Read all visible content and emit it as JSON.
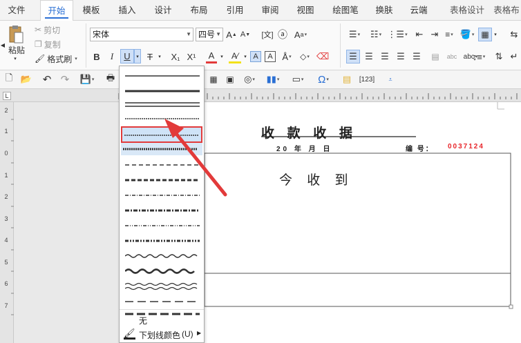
{
  "menu": {
    "tabs": [
      "文件",
      "开始",
      "模板",
      "插入",
      "设计",
      "布局",
      "引用",
      "审阅",
      "视图",
      "绘图笔",
      "换肤",
      "云端",
      "表格设计",
      "表格布"
    ],
    "active": "开始"
  },
  "ribbon": {
    "paste_label": "粘贴",
    "cut_label": "剪切",
    "copy_label": "复制",
    "format_painter_label": "格式刷",
    "font_name": "宋体",
    "font_size": "四号",
    "bold": "B",
    "italic": "I",
    "underline": "U",
    "strikethrough": "T",
    "subscript": "X₁",
    "superscript": "X¹",
    "font_color_letter": "A"
  },
  "underline_menu": {
    "none_label": "无",
    "color_label": "下划线颜色",
    "color_shortcut": "(U)"
  },
  "ruler": {
    "vertical_numbers": [
      "2",
      "1",
      "0",
      "1",
      "2",
      "3",
      "4",
      "5",
      "6",
      "7"
    ]
  },
  "document": {
    "title": "收 款 收 据",
    "date_line": "20 年 月 日",
    "number_label": "编 号：",
    "number_value": "0037124",
    "received_text": "今 收 到"
  },
  "colors": {
    "accent_blue": "#2a6fd4",
    "highlight_red": "#e23a3a",
    "number_red": "#e8262b"
  }
}
